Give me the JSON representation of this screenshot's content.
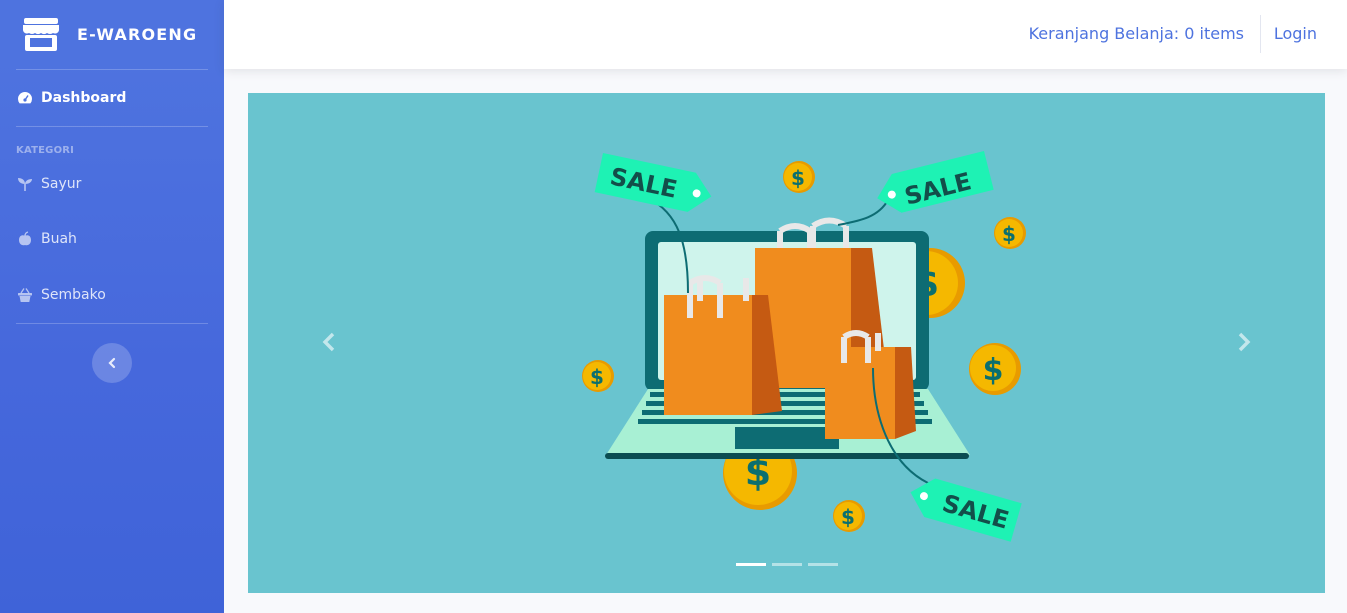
{
  "brand": {
    "name": "E-WAROENG"
  },
  "sidebar": {
    "dashboard_label": "Dashboard",
    "heading": "KATEGORI",
    "items": [
      {
        "label": "Sayur",
        "icon": "seedling-icon"
      },
      {
        "label": "Buah",
        "icon": "apple-icon"
      },
      {
        "label": "Sembako",
        "icon": "basket-icon"
      }
    ]
  },
  "topbar": {
    "cart_label": "Keranjang Belanja: 0 items",
    "login_label": "Login"
  },
  "carousel": {
    "tag_text": "SALE",
    "coin_symbol": "$",
    "slides_count": 3,
    "active_slide": 1
  },
  "colors": {
    "sidebar": "#4e73df",
    "carousel_bg": "#69c4cf",
    "bag": "#f08c1e",
    "tag": "#1ef2b4",
    "coin": "#f5b800"
  }
}
